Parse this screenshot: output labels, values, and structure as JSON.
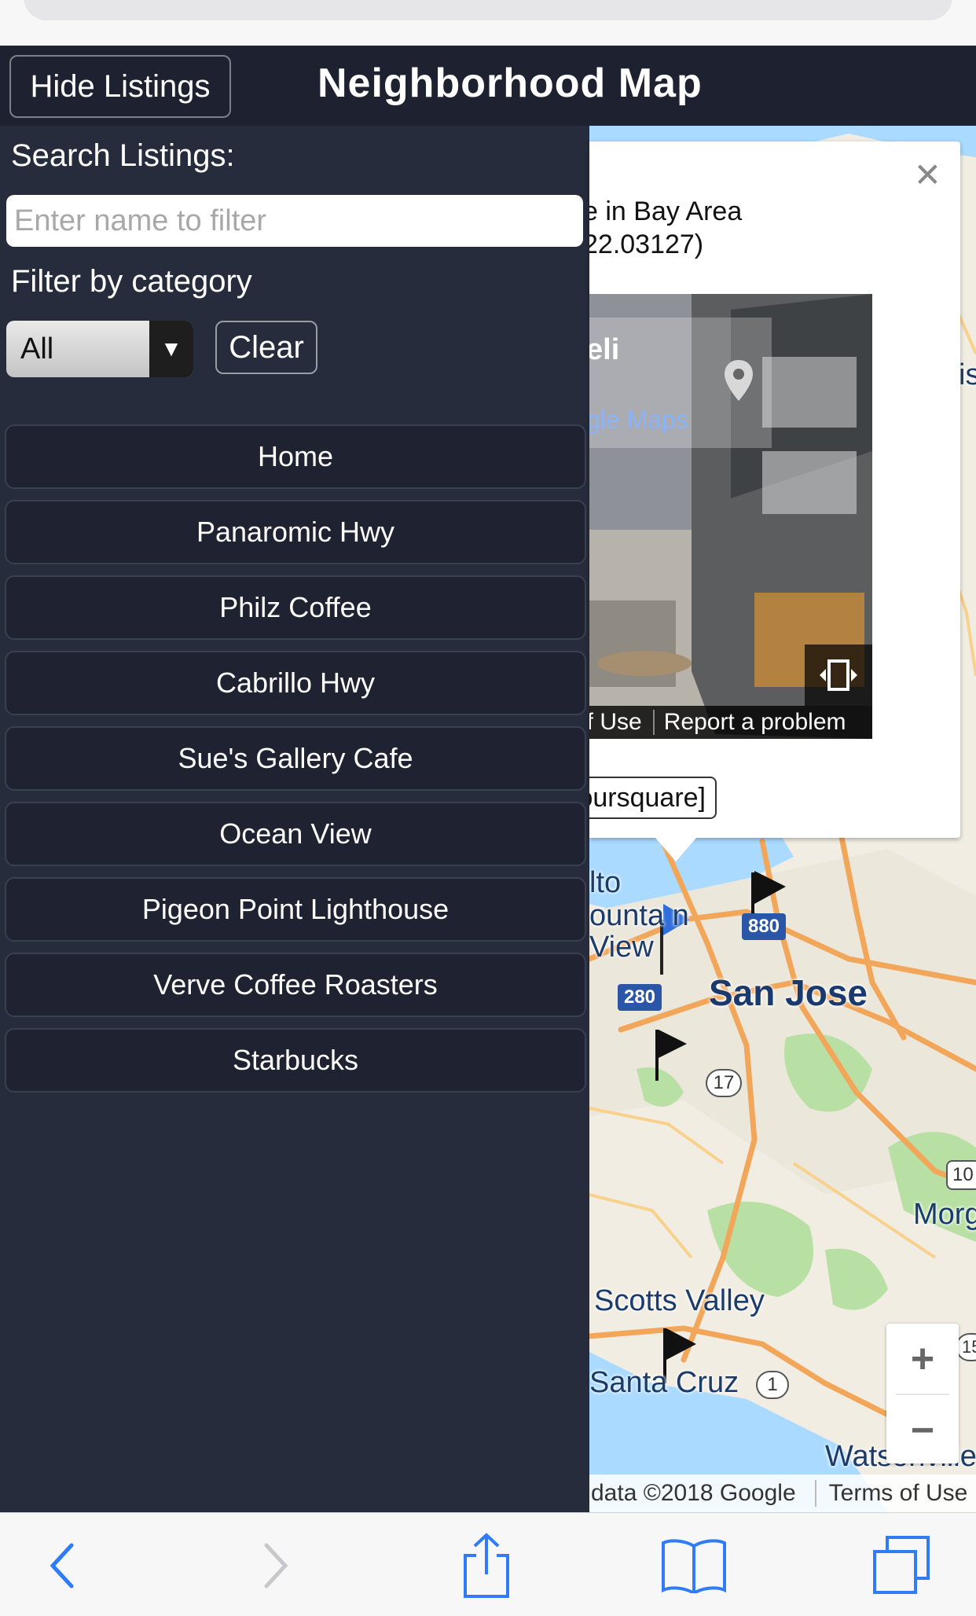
{
  "header": {
    "hide_button": "Hide Listings",
    "title": "Neighborhood Map"
  },
  "sidebar": {
    "search_label": "Search Listings:",
    "search_placeholder": "Enter name to filter",
    "filter_label": "Filter by category",
    "category_selected": "All",
    "clear_label": "Clear",
    "listings": [
      "Home",
      "Panaromic Hwy",
      "Philz Coffee",
      "Cabrillo Hwy",
      "Sue's Gallery Cafe",
      "Ocean View",
      "Pigeon Point Lighthouse",
      "Verve Coffee Roasters",
      "Starbucks"
    ]
  },
  "info_window": {
    "line1": "e in Bay Area",
    "line2": "22.03127)",
    "streetview_title": "eli",
    "streetview_link": "gle Maps",
    "terms": "of Use",
    "report": "Report a problem",
    "foursquare_button": "oursquare]"
  },
  "map": {
    "labels": {
      "alto": "lto",
      "mountain": "ounta n",
      "view": "View",
      "san_jose": "San Jose",
      "morgan": "Morg",
      "scotts_valley": "Scotts Valley",
      "santa_cruz": "Santa Cruz",
      "watsonville": "Watsonville",
      "edge_is": "is"
    },
    "shields": {
      "i880": "880",
      "i280": "280",
      "r17": "17",
      "r1": "1",
      "us101": "10",
      "r15": "15"
    },
    "attribution": "data ©2018 Google",
    "terms": "Terms of Use",
    "zoom_in": "+",
    "zoom_out": "−"
  },
  "colors": {
    "header_bg": "#1e2130",
    "sidebar_bg": "#272c3c",
    "accent_blue": "#2f6fdb"
  }
}
